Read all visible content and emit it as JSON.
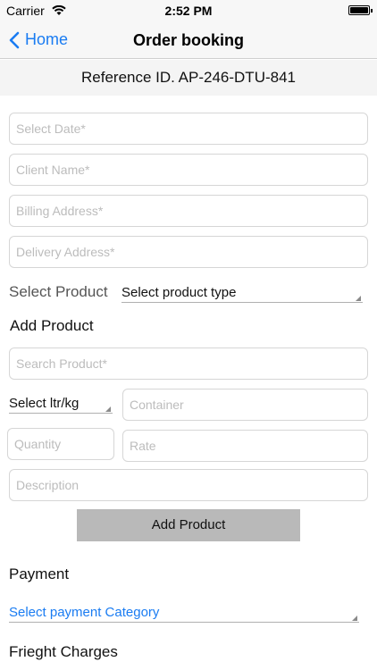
{
  "status": {
    "carrier": "Carrier",
    "time": "2:52 PM",
    "icons": [
      "wifi-icon",
      "battery-icon"
    ]
  },
  "nav": {
    "back_label": "Home",
    "title": "Order booking"
  },
  "reference": "Reference ID. AP-246-DTU-841",
  "form": {
    "date_placeholder": "Select Date*",
    "client_placeholder": "Client Name*",
    "billing_placeholder": "Billing Address*",
    "delivery_placeholder": "Delivery Address*",
    "select_product_label": "Select Product",
    "product_type_value": "Select product type",
    "add_product_heading": "Add Product",
    "search_product_placeholder": "Search Product*",
    "unit_value": "Select ltr/kg",
    "container_placeholder": "Container",
    "quantity_placeholder": "Quantity",
    "rate_placeholder": "Rate",
    "description_placeholder": "Description",
    "add_product_button": "Add Product",
    "payment_label": "Payment",
    "payment_category_value": "Select payment Category",
    "freight_label": "Frieght Charges"
  },
  "colors": {
    "accent": "#1a7cf2",
    "button_bg": "#b9b9b9",
    "field_border": "#d6d6d6",
    "banner_bg": "#f4f4f4"
  }
}
